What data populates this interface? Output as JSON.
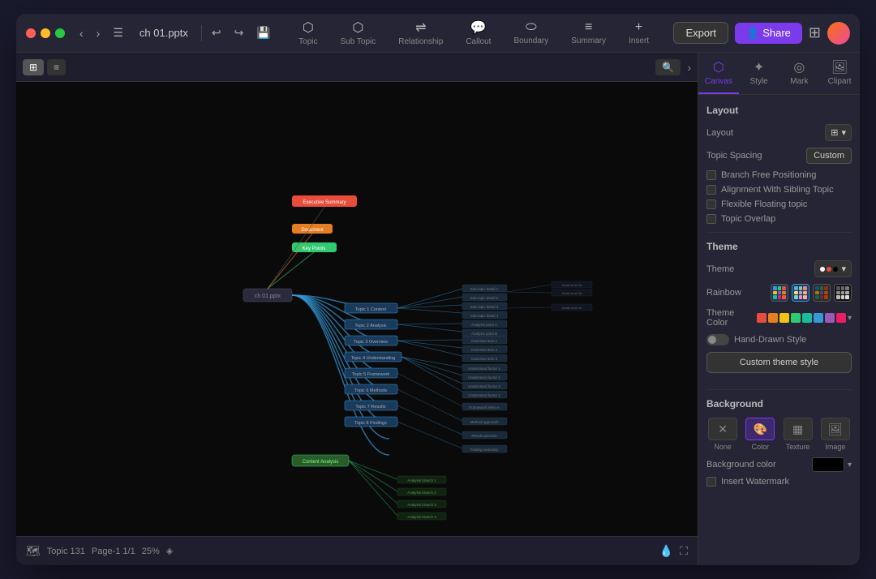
{
  "window": {
    "title": "ch 01.pptx"
  },
  "toolbar": {
    "back_label": "‹",
    "forward_label": "›",
    "undo_icon": "↩",
    "redo_icon": "↪",
    "file_icon": "📄",
    "tools": [
      {
        "id": "topic",
        "icon": "⬡",
        "label": "Topic"
      },
      {
        "id": "subtopic",
        "icon": "⬡",
        "label": "Sub Topic"
      },
      {
        "id": "relationship",
        "icon": "⇌",
        "label": "Relationship"
      },
      {
        "id": "callout",
        "icon": "💬",
        "label": "Callout"
      },
      {
        "id": "boundary",
        "icon": "⬭",
        "label": "Boundary"
      },
      {
        "id": "summary",
        "icon": "≡",
        "label": "Summary"
      },
      {
        "id": "insert",
        "icon": "+",
        "label": "Insert"
      }
    ],
    "export_label": "Export",
    "share_label": "Share"
  },
  "canvas": {
    "view_grid_label": "⊞",
    "view_list_label": "≡",
    "search_icon": "🔍",
    "footer": {
      "map_icon": "🗺",
      "topic_count": "Topic 131",
      "page": "Page-1  1/1",
      "zoom": "25%",
      "logo": "◈",
      "expand_icon": "⛶",
      "watermark_icon": "💧",
      "fullscreen_icon": "⛶"
    }
  },
  "right_panel": {
    "tabs": [
      {
        "id": "canvas",
        "icon": "⬡",
        "label": "Canvas",
        "active": true
      },
      {
        "id": "style",
        "icon": "✦",
        "label": "Style"
      },
      {
        "id": "mark",
        "icon": "◎",
        "label": "Mark"
      },
      {
        "id": "clipart",
        "icon": "🖼",
        "label": "Clipart"
      }
    ],
    "layout_section": {
      "title": "Layout",
      "layout_label": "Layout",
      "layout_icon": "⊞",
      "topic_spacing_label": "Topic Spacing",
      "topic_spacing_value": "Custom",
      "checkboxes": [
        {
          "id": "branch_free",
          "label": "Branch Free Positioning",
          "checked": false
        },
        {
          "id": "alignment",
          "label": "Alignment With Sibling Topic",
          "checked": false
        },
        {
          "id": "flexible",
          "label": "Flexible Floating topic",
          "checked": false
        },
        {
          "id": "overlap",
          "label": "Topic Overlap",
          "checked": false
        }
      ]
    },
    "theme_section": {
      "title": "Theme",
      "theme_label": "Theme",
      "rainbow_label": "Rainbow",
      "theme_color_label": "Theme Color",
      "hand_drawn_label": "Hand-Drawn Style",
      "custom_theme_label": "Custom theme style",
      "theme_colors": [
        "#e74c3c",
        "#e67e22",
        "#f1c40f",
        "#2ecc71",
        "#1abc9c",
        "#3498db",
        "#9b59b6",
        "#e91e63",
        "#ff5722"
      ]
    },
    "background_section": {
      "title": "Background",
      "options": [
        {
          "id": "none",
          "icon": "✕",
          "label": "None"
        },
        {
          "id": "color",
          "icon": "🎨",
          "label": "Color",
          "active": true
        },
        {
          "id": "texture",
          "icon": "▦",
          "label": "Texture"
        },
        {
          "id": "image",
          "icon": "🖼",
          "label": "Image"
        }
      ],
      "bg_color_label": "Background color",
      "bg_color": "#000000",
      "insert_watermark_label": "Insert Watermark"
    }
  }
}
